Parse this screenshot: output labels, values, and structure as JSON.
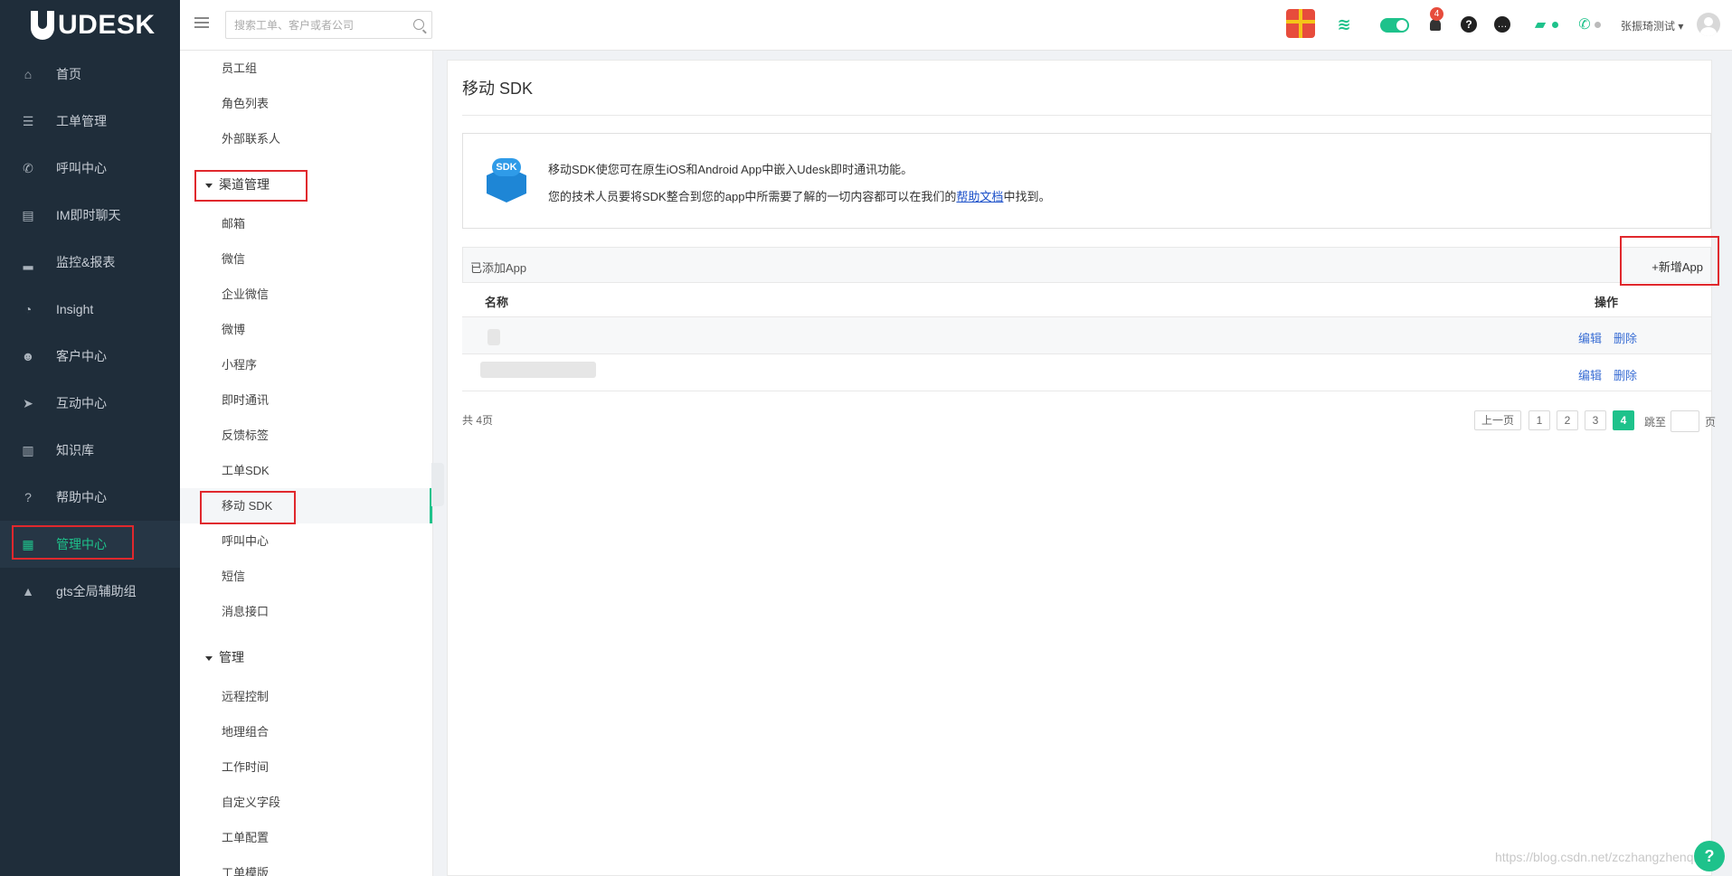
{
  "brand": {
    "logo_text": "UDESK"
  },
  "leftnav": {
    "items": [
      {
        "label": "首页",
        "icon": "home-icon"
      },
      {
        "label": "工单管理",
        "icon": "list-icon"
      },
      {
        "label": "呼叫中心",
        "icon": "phone-icon"
      },
      {
        "label": "IM即时聊天",
        "icon": "chat-icon"
      },
      {
        "label": "监控&报表",
        "icon": "bar-chart-icon"
      },
      {
        "label": "Insight",
        "icon": "pie-icon"
      },
      {
        "label": "客户中心",
        "icon": "users-icon"
      },
      {
        "label": "互动中心",
        "icon": "send-icon"
      },
      {
        "label": "知识库",
        "icon": "book-icon"
      },
      {
        "label": "帮助中心",
        "icon": "help-icon"
      },
      {
        "label": "管理中心",
        "icon": "grid-icon",
        "active": true
      },
      {
        "label": "gts全局辅助组",
        "icon": "triangle-logo-icon"
      }
    ]
  },
  "topbar": {
    "search_placeholder": "搜索工单、客户或者公司",
    "notification_count": "4",
    "user_name": "张振琦测试"
  },
  "submenu": {
    "top_items": [
      "员工组",
      "角色列表",
      "外部联系人"
    ],
    "group_channel": "渠道管理",
    "channel_items": [
      "邮箱",
      "微信",
      "企业微信",
      "微博",
      "小程序",
      "即时通讯",
      "反馈标签",
      "工单SDK",
      "移动 SDK",
      "呼叫中心",
      "短信",
      "消息接口"
    ],
    "group_manage": "管理",
    "manage_items": [
      "远程控制",
      "地理组合",
      "工作时间",
      "自定义字段",
      "工单配置",
      "工单模版"
    ]
  },
  "main": {
    "title": "移动 SDK",
    "sdk_badge": "SDK",
    "info_line1": "移动SDK使您可在原生iOS和Android App中嵌入Udesk即时通讯功能。",
    "info_line2_prefix": "您的技术人员要将SDK整合到您的app中所需要了解的一切内容都可以在我们的",
    "info_line2_link": "帮助文档",
    "info_line2_suffix": "中找到。",
    "added_label": "已添加App",
    "add_button": "+新增App",
    "columns": {
      "name": "名称",
      "action": "操作"
    },
    "rows": [
      {
        "edit": "编辑",
        "delete": "删除"
      },
      {
        "edit": "编辑",
        "delete": "删除"
      }
    ],
    "pagination": {
      "total": "共 4页",
      "prev": "上一页",
      "pages": [
        "1",
        "2",
        "3",
        "4"
      ],
      "current": "4",
      "jump_label": "跳至",
      "page_suffix": "页"
    }
  },
  "watermark": "https://blog.csdn.net/zczhangzhenqi",
  "float_help": "?",
  "colors": {
    "accent": "#1ec28b",
    "nav_bg": "#1f2d3a",
    "highlight_red": "#e0282d",
    "link": "#3a6ed4"
  }
}
